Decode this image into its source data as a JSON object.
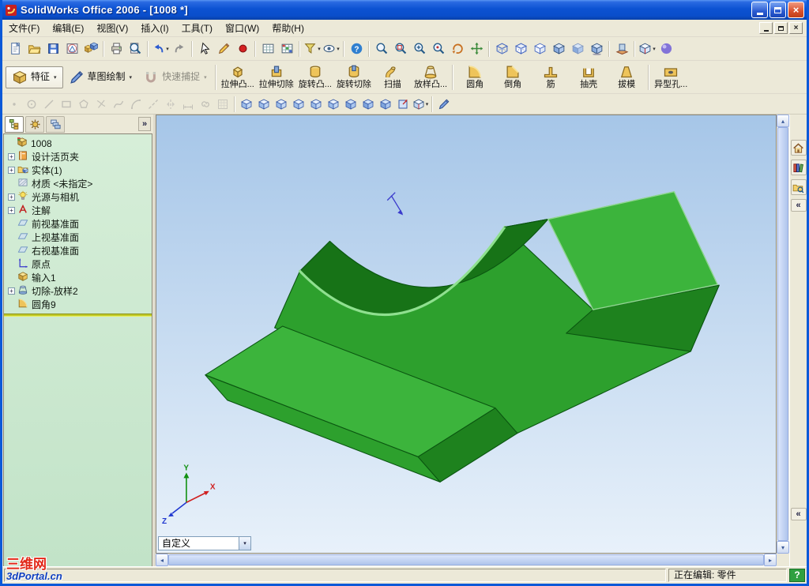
{
  "window": {
    "title": "SolidWorks Office 2006 - [1008 *]"
  },
  "menu": {
    "items": [
      "文件(F)",
      "编辑(E)",
      "视图(V)",
      "插入(I)",
      "工具(T)",
      "窗口(W)",
      "帮助(H)"
    ]
  },
  "toolbar_main": {
    "items": [
      {
        "name": "new-document",
        "icon": "page"
      },
      {
        "name": "open-document",
        "icon": "folder"
      },
      {
        "name": "save",
        "icon": "floppy"
      },
      {
        "name": "make-drawing-from-part",
        "icon": "drawing"
      },
      {
        "name": "make-assembly-from-part",
        "icon": "assembly"
      },
      {
        "sep": true
      },
      {
        "name": "print",
        "icon": "print"
      },
      {
        "name": "print-preview",
        "icon": "preview"
      },
      {
        "sep": true
      },
      {
        "name": "undo",
        "icon": "undo",
        "dropdown": true
      },
      {
        "name": "redo",
        "icon": "redo"
      },
      {
        "sep": true
      },
      {
        "name": "select",
        "icon": "cursor"
      },
      {
        "name": "edit-sketch",
        "icon": "pencil"
      },
      {
        "name": "record-macro",
        "icon": "reddot"
      },
      {
        "sep": true
      },
      {
        "name": "design-table",
        "icon": "grid"
      },
      {
        "name": "color-swatches",
        "icon": "cgrid"
      },
      {
        "sep": true
      },
      {
        "name": "selection-filter",
        "icon": "filterdrop",
        "dropdown": true
      },
      {
        "name": "hide-show-items",
        "icon": "eyedrop",
        "dropdown": true
      },
      {
        "sep": true
      },
      {
        "name": "help",
        "icon": "help"
      },
      {
        "sep": true
      },
      {
        "name": "zoom-to-fit",
        "icon": "magfit"
      },
      {
        "name": "zoom-to-area",
        "icon": "magarea"
      },
      {
        "name": "zoom-in-out",
        "icon": "magzoom"
      },
      {
        "name": "zoom-to-selection",
        "icon": "magsel"
      },
      {
        "name": "rotate-view",
        "icon": "rotate"
      },
      {
        "name": "pan",
        "icon": "pan"
      },
      {
        "sep": true
      },
      {
        "name": "wireframe",
        "icon": "cube-wire"
      },
      {
        "name": "hidden-lines-visible",
        "icon": "cube-hlv"
      },
      {
        "name": "hidden-lines-removed",
        "icon": "cube-hlr"
      },
      {
        "name": "shaded-with-edges",
        "icon": "cube-shaded-edges"
      },
      {
        "name": "shaded",
        "icon": "cube-shaded"
      },
      {
        "name": "shadows-in-shaded-mode",
        "icon": "cube-shadow"
      },
      {
        "sep": true
      },
      {
        "name": "section-view",
        "icon": "section"
      },
      {
        "sep": true
      },
      {
        "name": "standard-views",
        "icon": "cube-views",
        "dropdown": true
      },
      {
        "name": "apply-scene",
        "icon": "sphere"
      }
    ]
  },
  "toolbar_features": {
    "items": [
      {
        "name": "features-tab",
        "label": "特征",
        "icon": "feat-tab",
        "layout": "h",
        "active": true,
        "dropdown": true
      },
      {
        "name": "sketch",
        "label": "草图绘制",
        "icon": "sketchbtn",
        "layout": "h",
        "dropdown": true
      },
      {
        "name": "quick-snaps",
        "label": "快速捕捉",
        "icon": "snap",
        "layout": "h",
        "dropdown": true,
        "disabled": true
      },
      {
        "sep": true
      },
      {
        "name": "extruded-boss",
        "label": "拉伸凸...",
        "icon": "boss"
      },
      {
        "name": "extruded-cut",
        "label": "拉伸切除",
        "icon": "cut"
      },
      {
        "name": "revolved-boss",
        "label": "旋转凸...",
        "icon": "revolve"
      },
      {
        "name": "revolved-cut",
        "label": "旋转切除",
        "icon": "revcut"
      },
      {
        "name": "swept-boss",
        "label": "扫描",
        "icon": "sweep"
      },
      {
        "name": "lofted-boss",
        "label": "放样凸...",
        "icon": "loft"
      },
      {
        "sep": true
      },
      {
        "name": "fillet",
        "label": "圆角",
        "icon": "filletfeat"
      },
      {
        "name": "chamfer",
        "label": "倒角",
        "icon": "chamfer"
      },
      {
        "name": "rib",
        "label": "筋",
        "icon": "rib"
      },
      {
        "name": "shell",
        "label": "抽壳",
        "icon": "shell"
      },
      {
        "name": "draft",
        "label": "拔模",
        "icon": "draft"
      },
      {
        "sep": true
      },
      {
        "name": "hole-wizard",
        "label": "异型孔...",
        "icon": "hole"
      }
    ]
  },
  "toolbar_sketch_views": {
    "items": [
      {
        "name": "sketch-point",
        "icon": "sk-point",
        "disabled": true
      },
      {
        "name": "sketch-circle",
        "icon": "sk-circle",
        "disabled": true
      },
      {
        "name": "sketch-line",
        "icon": "sk-line",
        "disabled": true
      },
      {
        "name": "sketch-rectangle",
        "icon": "sk-rect",
        "disabled": true
      },
      {
        "name": "sketch-polygon",
        "icon": "sk-poly",
        "disabled": true
      },
      {
        "name": "sketch-trim",
        "icon": "sk-trim",
        "disabled": true
      },
      {
        "name": "sketch-spline",
        "icon": "sk-spline",
        "disabled": true
      },
      {
        "name": "sketch-arc",
        "icon": "sk-arc",
        "disabled": true
      },
      {
        "name": "sketch-centerline",
        "icon": "sk-center",
        "disabled": true
      },
      {
        "name": "sketch-mirror",
        "icon": "sk-mirror",
        "disabled": true
      },
      {
        "name": "sketch-dimension",
        "icon": "sk-dim",
        "disabled": true
      },
      {
        "name": "sketch-relations",
        "icon": "sk-rel",
        "disabled": true
      },
      {
        "name": "sketch-grid",
        "icon": "sk-grid",
        "disabled": true
      },
      {
        "sep": true
      },
      {
        "name": "view-front",
        "icon": "vc"
      },
      {
        "name": "view-back",
        "icon": "vc"
      },
      {
        "name": "view-left",
        "icon": "vc"
      },
      {
        "name": "view-right",
        "icon": "vc"
      },
      {
        "name": "view-top",
        "icon": "vc"
      },
      {
        "name": "view-bottom",
        "icon": "vc"
      },
      {
        "name": "view-isometric",
        "icon": "vc-iso"
      },
      {
        "name": "view-trimetric",
        "icon": "vc-iso"
      },
      {
        "name": "view-dimetric",
        "icon": "vc-iso"
      },
      {
        "name": "view-normal-to",
        "icon": "vc-norm"
      },
      {
        "name": "view-orientation",
        "icon": "cube-views",
        "dropdown": true
      },
      {
        "sep": true
      },
      {
        "name": "3d-sketch",
        "icon": "sketchbtn"
      }
    ]
  },
  "feature_tree": {
    "tabs": [
      {
        "name": "featuremanager-tab",
        "icon": "tab-fm"
      },
      {
        "name": "propertymanager-tab",
        "icon": "tab-pm"
      },
      {
        "name": "configurationmanager-tab",
        "icon": "tab-cm"
      }
    ],
    "collapse_label": "»",
    "root": {
      "label": "1008",
      "icon": "part"
    },
    "items": [
      {
        "label": "设计活页夹",
        "icon": "binder",
        "expandable": true
      },
      {
        "label": "实体(1)",
        "icon": "solids",
        "expandable": true
      },
      {
        "label": "材质 <未指定>",
        "icon": "material"
      },
      {
        "label": "光源与相机",
        "icon": "lights",
        "expandable": true
      },
      {
        "label": "注解",
        "icon": "annot",
        "expandable": true
      },
      {
        "label": "前视基准面",
        "icon": "plane"
      },
      {
        "label": "上视基准面",
        "icon": "plane"
      },
      {
        "label": "右视基准面",
        "icon": "plane"
      },
      {
        "label": "原点",
        "icon": "origin"
      },
      {
        "label": "输入1",
        "icon": "imported"
      },
      {
        "label": "切除-放样2",
        "icon": "loftcut",
        "expandable": true
      },
      {
        "label": "圆角9",
        "icon": "filletfeat"
      }
    ]
  },
  "viewport": {
    "combo_value": "自定义",
    "triad": {
      "x": "X",
      "y": "Y",
      "z": "Z"
    }
  },
  "task_pane": {
    "items": [
      {
        "name": "solidworks-resources",
        "icon": "tp-home"
      },
      {
        "name": "design-library",
        "icon": "tp-lib"
      },
      {
        "name": "file-explorer",
        "icon": "tp-folder"
      },
      {
        "name": "task-pane-collapse",
        "label": "«"
      }
    ],
    "lower_label": "«"
  },
  "status_bar": {
    "editing": "正在编辑: 零件",
    "help_label": "?"
  },
  "watermark": {
    "line1": "三维网",
    "line2": "3dPortal.cn"
  },
  "colors": {
    "titlebar_blue": "#0c52d2",
    "chrome": "#ece9d8",
    "viewport_top": "#a6c6e8",
    "viewport_bottom": "#e8f1fa",
    "tree_top": "#d6eed8",
    "tree_bottom": "#c2e3c8",
    "model_top": "#3cb43c",
    "model_front": "#2da02d",
    "model_side": "#1e821e",
    "model_dark": "#177317",
    "model_highlight": "#8fe08f",
    "rollback_bar": "#c2ca28",
    "status_help_green": "#2fa040",
    "watermark_red": "#e22818",
    "watermark_blue": "#1040c0"
  }
}
